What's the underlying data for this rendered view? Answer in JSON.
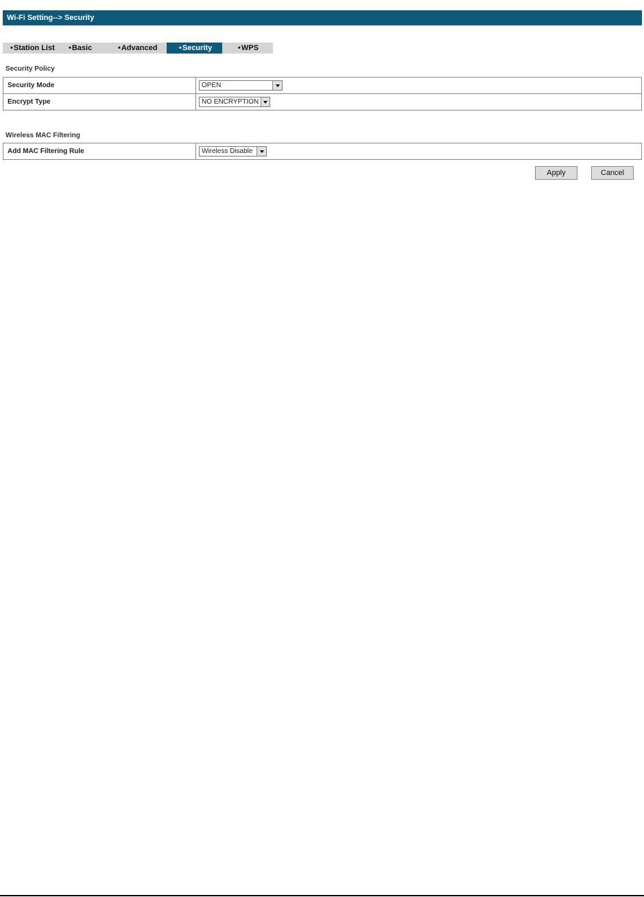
{
  "header": {
    "title": "Wi-Fi Setting--> Security"
  },
  "tabs": [
    {
      "label": "Station List",
      "active": false
    },
    {
      "label": "Basic",
      "active": false
    },
    {
      "label": "Advanced",
      "active": false
    },
    {
      "label": "Security",
      "active": true
    },
    {
      "label": "WPS",
      "active": false
    }
  ],
  "tab_bullet": "•",
  "security_policy": {
    "title": "Security Policy",
    "rows": [
      {
        "label": "Security Mode",
        "value": "OPEN"
      },
      {
        "label": "Encrypt Type",
        "value": "NO ENCRYPTION"
      }
    ]
  },
  "mac_filtering": {
    "title": "Wireless MAC Filtering",
    "rows": [
      {
        "label": "Add MAC Filtering Rule",
        "value": "Wireless Disable"
      }
    ]
  },
  "buttons": {
    "apply": "Apply",
    "cancel": "Cancel"
  },
  "colors": {
    "accent": "#0d5a7c",
    "tab_bar": "#d4d4d4"
  }
}
